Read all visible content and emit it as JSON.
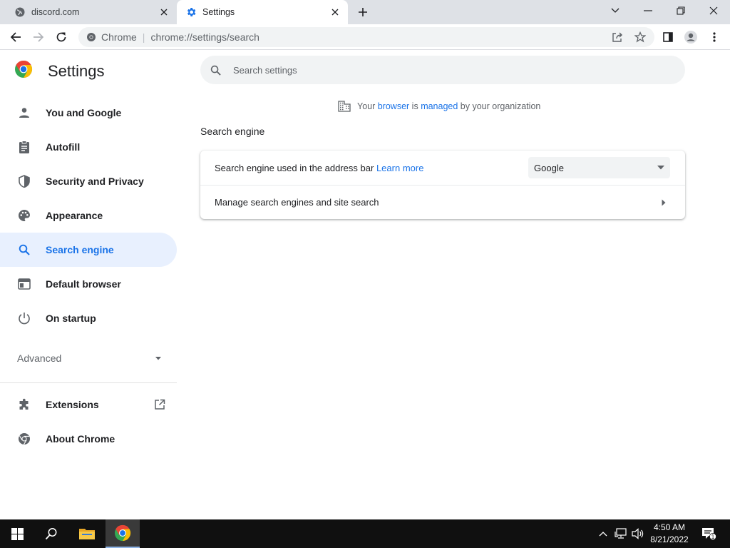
{
  "browser": {
    "tabs": [
      {
        "title": "discord.com",
        "icon": "globe-icon",
        "active": false
      },
      {
        "title": "Settings",
        "icon": "gear-icon",
        "active": true
      }
    ],
    "omnibox": {
      "site_chip": "Chrome",
      "url": "chrome://settings/search"
    }
  },
  "sidebar": {
    "title": "Settings",
    "items": [
      {
        "label": "You and Google",
        "icon": "person-icon"
      },
      {
        "label": "Autofill",
        "icon": "clipboard-icon"
      },
      {
        "label": "Security and Privacy",
        "icon": "shield-icon"
      },
      {
        "label": "Appearance",
        "icon": "palette-icon"
      },
      {
        "label": "Search engine",
        "icon": "search-icon",
        "selected": true
      },
      {
        "label": "Default browser",
        "icon": "browser-window-icon"
      },
      {
        "label": "On startup",
        "icon": "power-icon"
      }
    ],
    "advanced_label": "Advanced",
    "bottom_items": [
      {
        "label": "Extensions",
        "icon": "puzzle-icon"
      },
      {
        "label": "About Chrome",
        "icon": "chrome-icon"
      }
    ]
  },
  "main": {
    "search_placeholder": "Search settings",
    "managed": {
      "prefix": "Your ",
      "link1": "browser",
      "middle": " is ",
      "link2": "managed",
      "suffix": " by your organization"
    },
    "section_title": "Search engine",
    "row1": {
      "label": "Search engine used in the address bar",
      "link": "Learn more",
      "selected_value": "Google"
    },
    "row2": {
      "label": "Manage search engines and site search"
    }
  },
  "taskbar": {
    "time": "4:50 AM",
    "date": "8/21/2022",
    "notification_count": "1"
  },
  "colors": {
    "accent": "#1a73e8",
    "selected_bg": "#e8f0fe",
    "tabstrip": "#dee1e6",
    "taskbar": "#101010"
  }
}
